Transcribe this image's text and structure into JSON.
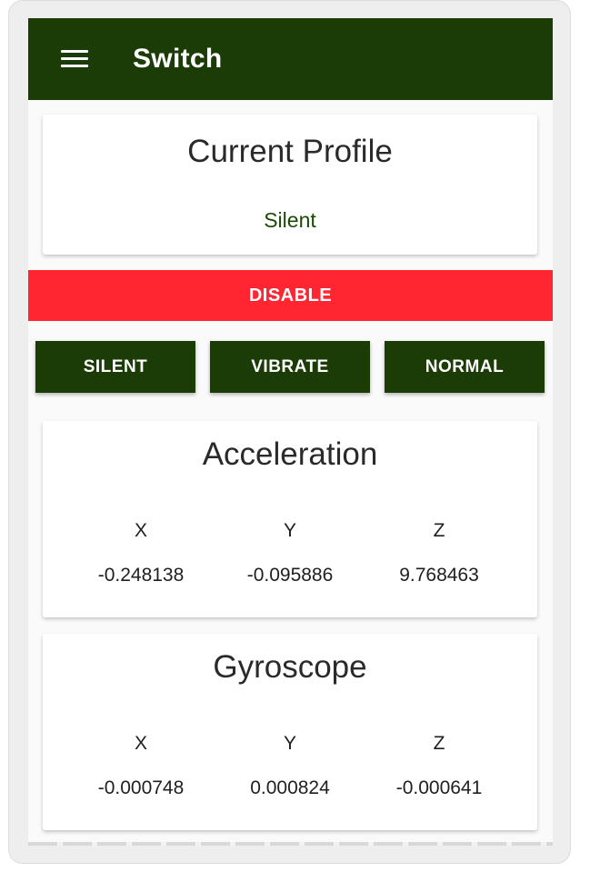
{
  "appbar": {
    "title": "Switch",
    "menu_icon": "hamburger-menu-icon"
  },
  "profile": {
    "heading": "Current Profile",
    "value": "Silent"
  },
  "actions": {
    "disable_label": "DISABLE",
    "silent_label": "SILENT",
    "vibrate_label": "VIBRATE",
    "normal_label": "NORMAL"
  },
  "acceleration": {
    "heading": "Acceleration",
    "axes": [
      {
        "label": "X",
        "value": "-0.248138"
      },
      {
        "label": "Y",
        "value": "-0.095886"
      },
      {
        "label": "Z",
        "value": "9.768463"
      }
    ]
  },
  "gyroscope": {
    "heading": "Gyroscope",
    "axes": [
      {
        "label": "X",
        "value": "-0.000748"
      },
      {
        "label": "Y",
        "value": "0.000824"
      },
      {
        "label": "Z",
        "value": "-0.000641"
      }
    ]
  },
  "colors": {
    "primary": "#1b3b07",
    "danger": "#ff2632",
    "profile_text": "#1b4a07"
  }
}
